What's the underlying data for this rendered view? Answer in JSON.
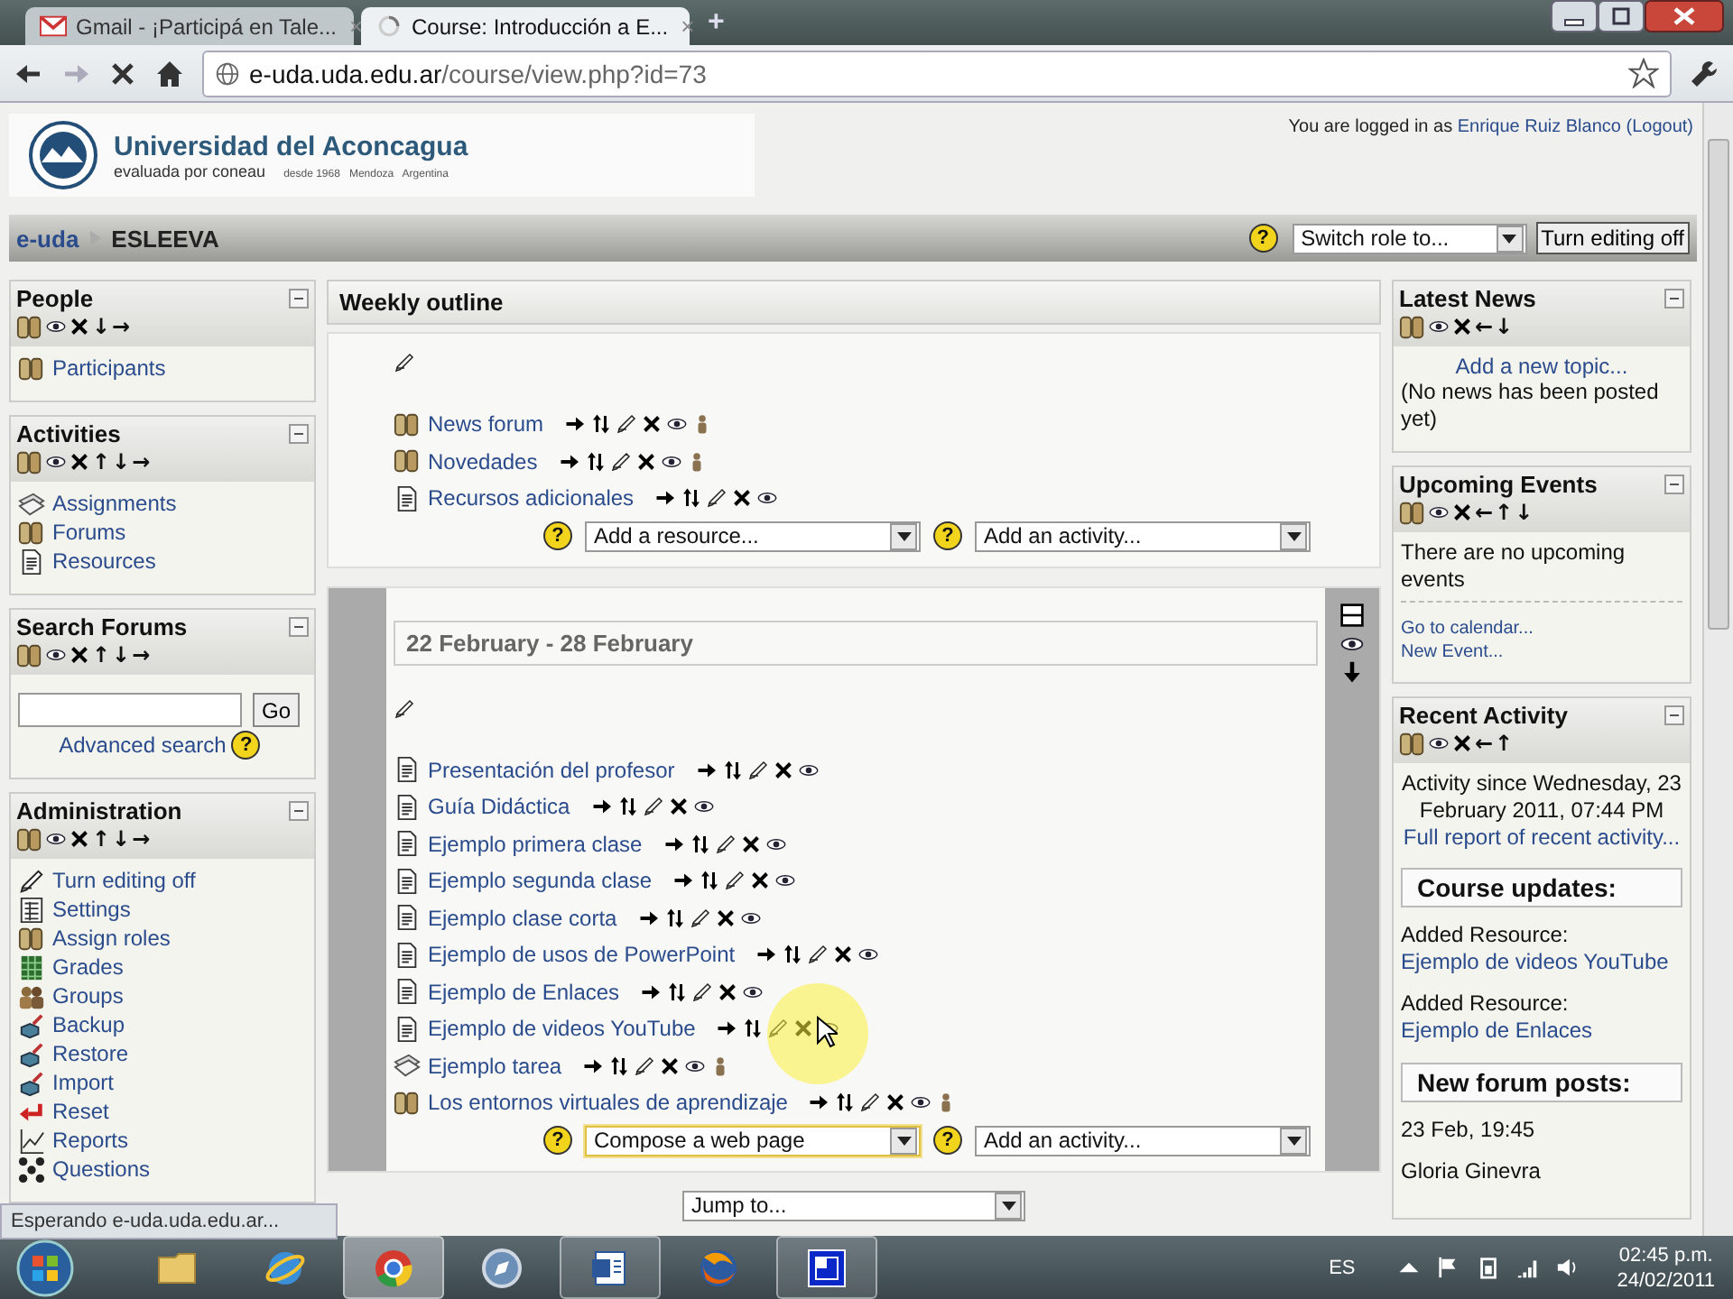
{
  "browser": {
    "tabs": [
      {
        "title": "Gmail - ¡Participá en Tale...",
        "close": "×",
        "kind": "mail",
        "selected": false
      },
      {
        "title": "Course: Introducción a E...",
        "close": "×",
        "kind": "loading",
        "selected": true
      }
    ],
    "new_tab": "+",
    "address": {
      "host": "e-uda.uda.edu.ar",
      "path": "/course/view.php?id=73"
    }
  },
  "header": {
    "title": "Universidad del Aconcagua",
    "subtitle": "evaluada por coneau",
    "tagline": "desde 1968   Mendoza   Argentina",
    "login_text": "You are logged in as",
    "user": "Enrique Ruiz Blanco",
    "logout": "(Logout)"
  },
  "navbar": {
    "crumbs": [
      {
        "label": "e-uda",
        "link": true
      },
      {
        "label": "ESLEEVA",
        "link": false
      }
    ],
    "help": "?",
    "role_select": "Switch role to...",
    "editing_button": "Turn editing off"
  },
  "left_blocks": [
    {
      "kind": "list",
      "title": "People",
      "arrows": "↓→",
      "items": [
        {
          "label": "Participants",
          "kind": "people"
        }
      ]
    },
    {
      "kind": "list",
      "title": "Activities",
      "arrows": "↑↓→",
      "items": [
        {
          "label": "Assignments",
          "kind": "assignment"
        },
        {
          "label": "Forums",
          "kind": "forum"
        },
        {
          "label": "Resources",
          "kind": "resource"
        }
      ]
    },
    {
      "kind": "search",
      "title": "Search Forums",
      "arrows": "↑↓→",
      "button": "Go",
      "link": "Advanced search",
      "help": "?"
    },
    {
      "kind": "list",
      "title": "Administration",
      "arrows": "↑↓→",
      "items": [
        {
          "label": "Turn editing off",
          "kind": "edit"
        },
        {
          "label": "Settings",
          "kind": "settings"
        },
        {
          "label": "Assign roles",
          "kind": "people"
        },
        {
          "label": "Grades",
          "kind": "grades"
        },
        {
          "label": "Groups",
          "kind": "groups"
        },
        {
          "label": "Backup",
          "kind": "box"
        },
        {
          "label": "Restore",
          "kind": "box"
        },
        {
          "label": "Import",
          "kind": "box"
        },
        {
          "label": "Reset",
          "kind": "reset"
        },
        {
          "label": "Reports",
          "kind": "reports"
        },
        {
          "label": "Questions",
          "kind": "questions"
        }
      ]
    }
  ],
  "course": {
    "title": "Weekly outline",
    "sections": [
      {
        "current": false,
        "items": [
          {
            "label": "News forum",
            "kind": "forum",
            "group_mode": true
          },
          {
            "label": "Novedades",
            "kind": "forum",
            "group_mode": true
          },
          {
            "label": "Recursos adicionales",
            "kind": "resource",
            "group_mode": false
          }
        ],
        "resource_select": {
          "value": "Add a resource...",
          "focused": false,
          "help": "?"
        },
        "activity_select": {
          "value": "Add an activity...",
          "help": "?"
        }
      },
      {
        "current": true,
        "date": "22 February - 28 February",
        "items": [
          {
            "label": "Presentación del profesor",
            "kind": "resource",
            "group_mode": false
          },
          {
            "label": "Guía Didáctica",
            "kind": "resource",
            "group_mode": false
          },
          {
            "label": "Ejemplo primera clase",
            "kind": "resource",
            "group_mode": false
          },
          {
            "label": "Ejemplo segunda clase",
            "kind": "resource",
            "group_mode": false
          },
          {
            "label": "Ejemplo clase corta",
            "kind": "resource",
            "group_mode": false
          },
          {
            "label": "Ejemplo de usos de PowerPoint",
            "kind": "resource",
            "group_mode": false
          },
          {
            "label": "Ejemplo de Enlaces",
            "kind": "resource",
            "group_mode": false
          },
          {
            "label": "Ejemplo de videos YouTube",
            "kind": "resource",
            "group_mode": false
          },
          {
            "label": "Ejemplo tarea",
            "kind": "assignment",
            "group_mode": true
          },
          {
            "label": "Los entornos virtuales de aprendizaje",
            "kind": "forum",
            "group_mode": true
          }
        ],
        "resource_select": {
          "value": "Compose a web page",
          "focused": true,
          "help": "?"
        },
        "activity_select": {
          "value": "Add an activity...",
          "help": "?"
        }
      }
    ],
    "jump": "Jump to..."
  },
  "right_blocks": [
    {
      "kind": "news",
      "title": "Latest News",
      "arrows": "←↓",
      "link": "Add a new topic...",
      "text": "(No news has been posted yet)"
    },
    {
      "kind": "events",
      "title": "Upcoming Events",
      "arrows": "←↑↓",
      "text": "There are no upcoming events",
      "links": [
        "Go to calendar...",
        "New Event..."
      ]
    },
    {
      "kind": "activity",
      "title": "Recent Activity",
      "arrows": "←↑",
      "text": "Activity since Wednesday, 23 February 2011, 07:44 PM",
      "link": "Full report of recent activity...",
      "sections": [
        {
          "heading": "Course updates:",
          "entries": [
            {
              "text": "Added Resource:",
              "link": "Ejemplo de videos YouTube"
            },
            {
              "text": "Added Resource:",
              "link": "Ejemplo de Enlaces"
            }
          ]
        },
        {
          "heading": "New forum posts:",
          "entries": [
            {
              "text": "23 Feb, 19:45"
            },
            {
              "text": "Gloria Ginevra"
            }
          ]
        }
      ]
    }
  ],
  "status": "Esperando e-uda.uda.edu.ar...",
  "taskbar": {
    "apps": [
      {
        "kind": "folder",
        "running": false,
        "selected": false
      },
      {
        "kind": "ie",
        "running": false,
        "selected": false
      },
      {
        "kind": "chrome",
        "running": true,
        "selected": true
      },
      {
        "kind": "safari",
        "running": false,
        "selected": false
      },
      {
        "kind": "word",
        "running": true,
        "selected": false
      },
      {
        "kind": "firefox",
        "running": false,
        "selected": false
      },
      {
        "kind": "window",
        "running": true,
        "selected": false
      }
    ],
    "language": "ES",
    "time": "02:45 p.m.",
    "date": "24/02/2011"
  }
}
